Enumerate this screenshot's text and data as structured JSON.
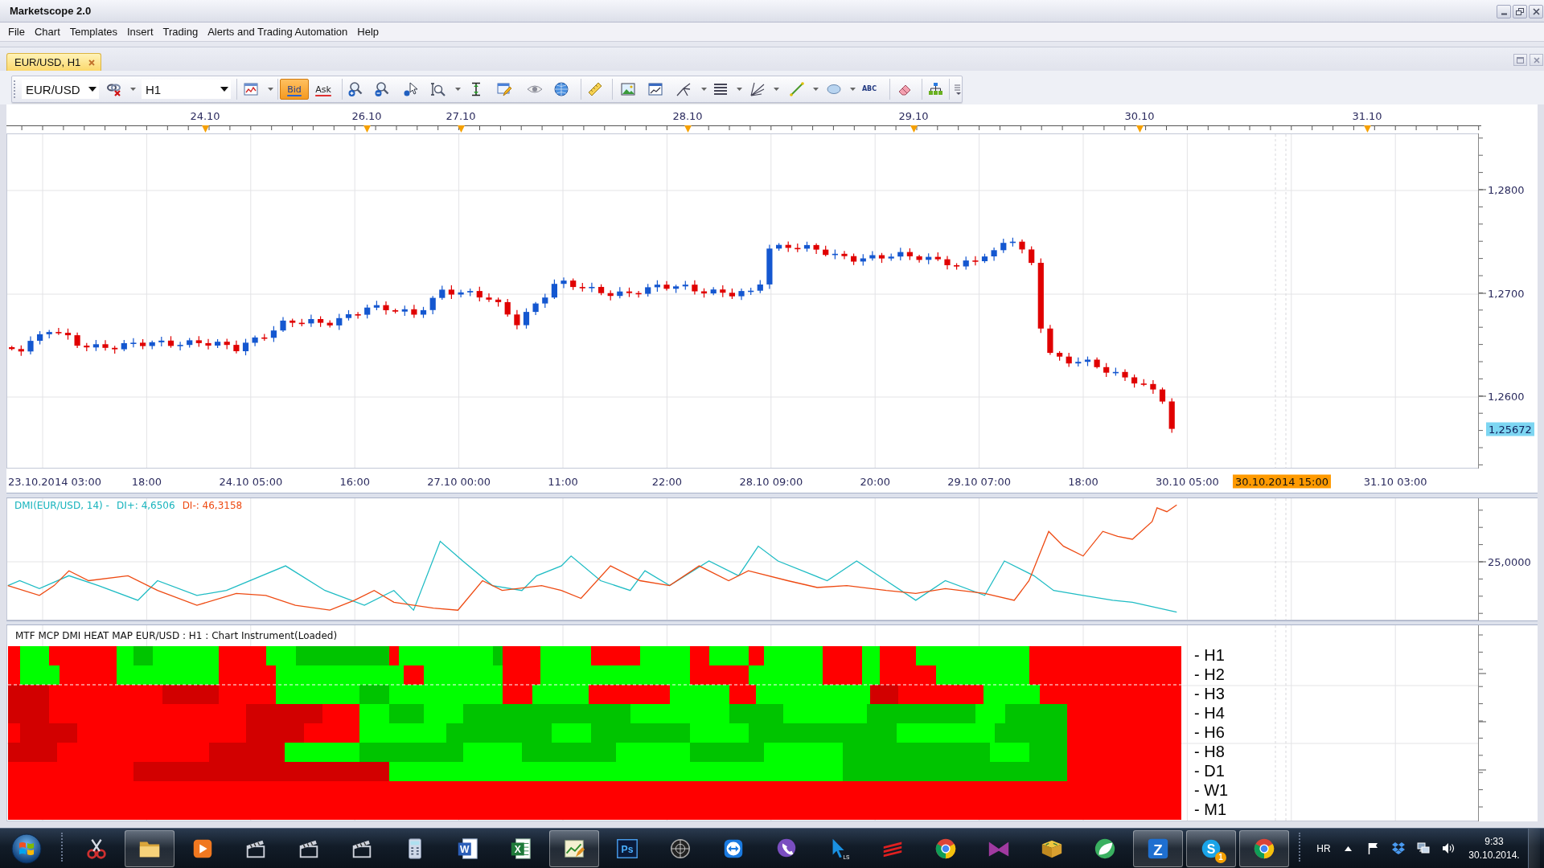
{
  "window": {
    "title": "Marketscope 2.0"
  },
  "menu": [
    "File",
    "Chart",
    "Templates",
    "Insert",
    "Trading",
    "Alerts and Trading Automation",
    "Help"
  ],
  "tabs": [
    {
      "label": "EUR/USD, H1",
      "selected": true
    }
  ],
  "toolbar": {
    "symbol": "EUR/USD",
    "timeframe": "H1",
    "price_modes": [
      {
        "label": "Bid",
        "selected": true
      },
      {
        "label": "Ask",
        "selected": false
      }
    ],
    "text_tool": "ABC"
  },
  "price_chart": {
    "top_axis": [
      "24.10",
      "26.10",
      "27.10",
      "28.10",
      "29.10",
      "30.10",
      "31.10"
    ],
    "price_axis": [
      "1,2800",
      "1,2700",
      "1,2600"
    ],
    "current_price": "1,25672",
    "time_axis": [
      {
        "label": "23.10.2014 03:00",
        "cursor": false
      },
      {
        "label": "18:00",
        "cursor": false
      },
      {
        "label": "24.10 05:00",
        "cursor": false
      },
      {
        "label": "16:00",
        "cursor": false
      },
      {
        "label": "27.10 00:00",
        "cursor": false
      },
      {
        "label": "11:00",
        "cursor": false
      },
      {
        "label": "22:00",
        "cursor": false
      },
      {
        "label": "28.10 09:00",
        "cursor": false
      },
      {
        "label": "20:00",
        "cursor": false
      },
      {
        "label": "29.10 07:00",
        "cursor": false
      },
      {
        "label": "18:00",
        "cursor": false
      },
      {
        "label": "30.10 05:00",
        "cursor": false
      },
      {
        "label": "30.10.2014 15:00",
        "cursor": true
      },
      {
        "label": "31.10 03:00",
        "cursor": false
      }
    ]
  },
  "dmi_panel": {
    "name": "DMI(EUR/USD, 14) -",
    "di_plus": "DI+: 4,6506",
    "di_minus": "DI-: 46,3158",
    "axis": [
      "25,0000"
    ]
  },
  "heat_map": {
    "title": "MTF MCP DMI HEAT MAP EUR/USD : H1 : Chart Instrument(Loaded)",
    "rows": [
      "- H1",
      "- H2",
      "- H3",
      "- H4",
      "- H6",
      "- H8",
      "- D1",
      "- W1",
      "- M1"
    ]
  },
  "taskbar": {
    "apps": [
      {
        "kind": "scissors",
        "running": false
      },
      {
        "kind": "folder",
        "running": true
      },
      {
        "kind": "player",
        "running": false
      },
      {
        "kind": "clapper",
        "running": false
      },
      {
        "kind": "clapper",
        "running": false
      },
      {
        "kind": "clapper",
        "running": false
      },
      {
        "kind": "calculator",
        "running": false
      },
      {
        "kind": "document",
        "glyph": "W",
        "running": false
      },
      {
        "kind": "spreadsheet",
        "glyph": "X",
        "running": false
      },
      {
        "kind": "chartpen",
        "running": true
      },
      {
        "kind": "lettertile",
        "glyph": "Ps",
        "running": false
      },
      {
        "kind": "crosshair",
        "running": false
      },
      {
        "kind": "arrows",
        "running": false
      },
      {
        "kind": "phone",
        "running": false
      },
      {
        "kind": "pointer",
        "glyph": "LS",
        "running": false
      },
      {
        "kind": "stripes",
        "running": false
      },
      {
        "kind": "segments",
        "running": false
      },
      {
        "kind": "mshape",
        "running": false
      },
      {
        "kind": "book",
        "running": false
      },
      {
        "kind": "leaf",
        "running": false
      },
      {
        "kind": "zed",
        "glyph": "Z",
        "running": true
      },
      {
        "kind": "chat",
        "glyph": "S",
        "badge": "1",
        "running": true
      },
      {
        "kind": "segments",
        "running": true
      }
    ],
    "language": "HR",
    "time": "9:33",
    "date": "30.10.2014."
  }
}
